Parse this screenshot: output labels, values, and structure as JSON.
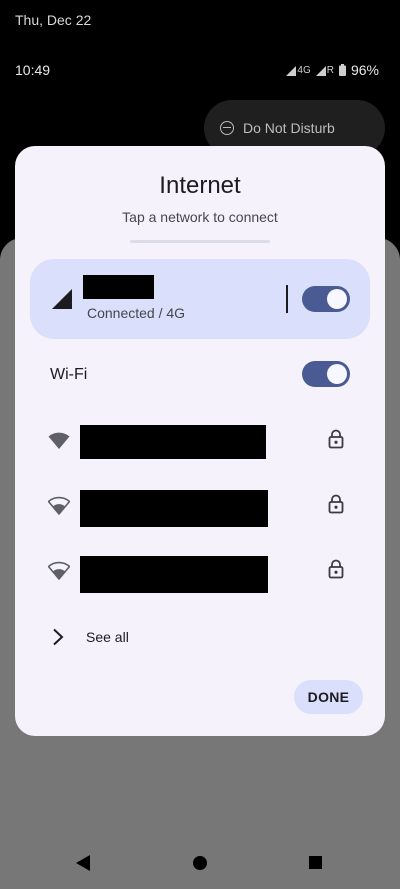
{
  "status_bar": {
    "date": "Thu, Dec 22",
    "time": "10:49",
    "network_4g_label": "4G",
    "roaming_label": "R",
    "battery_pct": "96%"
  },
  "dnd_tile": {
    "label": "Do Not Disturb"
  },
  "dialog": {
    "title": "Internet",
    "subtitle": "Tap a network to connect",
    "mobile": {
      "status": "Connected / 4G",
      "toggle_on": true,
      "icon": "cell-signal-icon"
    },
    "wifi": {
      "label": "Wi-Fi",
      "toggle_on": true,
      "networks": [
        {
          "icon": "wifi-full-icon",
          "locked": true
        },
        {
          "icon": "wifi-mid-icon",
          "locked": true
        },
        {
          "icon": "wifi-mid-icon",
          "locked": true
        }
      ]
    },
    "see_all": "See all",
    "done": "DONE"
  },
  "nav": {
    "icons": [
      "back-icon",
      "home-icon",
      "recents-icon"
    ]
  },
  "colors": {
    "panel_bg": "#f5f2fb",
    "accent_card": "#dadffb",
    "toggle_on": "#4a5b94"
  }
}
